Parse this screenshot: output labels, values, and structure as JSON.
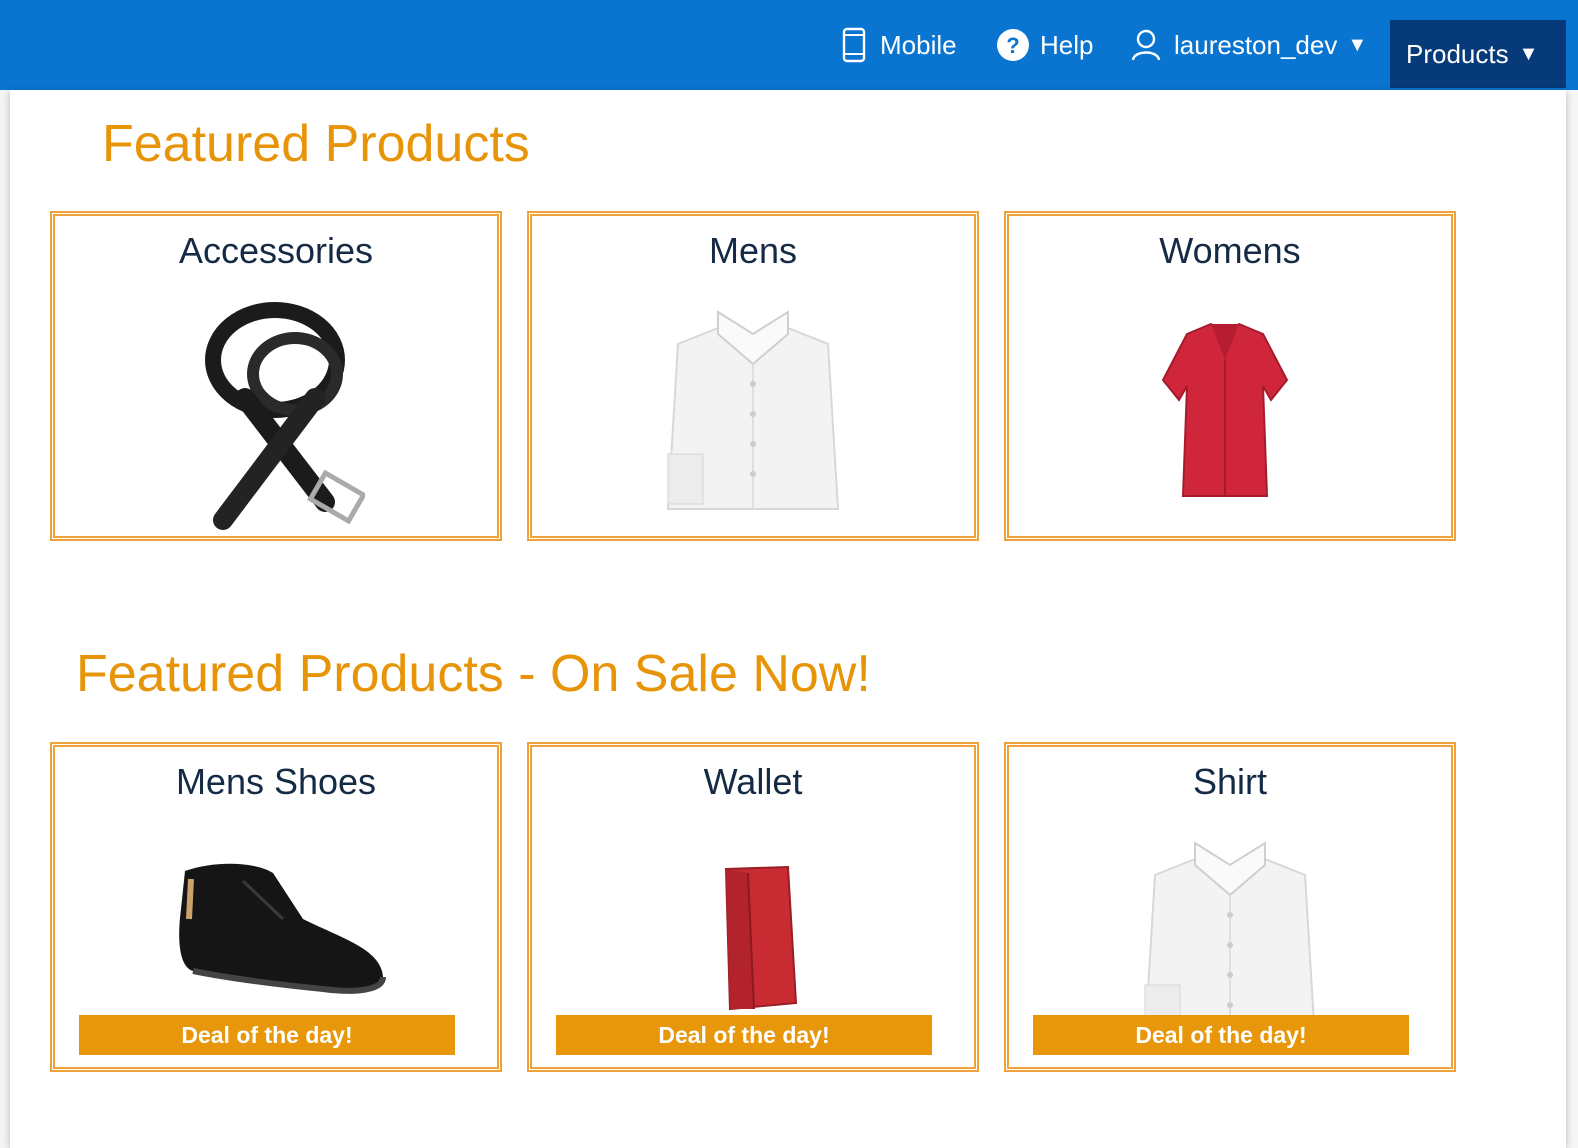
{
  "header": {
    "mobile_label": "Mobile",
    "help_label": "Help",
    "user_label": "laureston_dev",
    "products_label": "Products",
    "caret": "▼",
    "background_color": "#0a74d1",
    "active_color": "#073a78"
  },
  "featured": {
    "title": "Featured Products",
    "items": [
      {
        "label": "Accessories",
        "image": "belt-image"
      },
      {
        "label": "Mens",
        "image": "white-shirt-image"
      },
      {
        "label": "Womens",
        "image": "red-blouse-image"
      }
    ]
  },
  "sale": {
    "title": "Featured Products - On Sale Now!",
    "deal_label": "Deal of the day!",
    "items": [
      {
        "label": "Mens Shoes",
        "image": "shoe-image",
        "deal": "Deal of the day!"
      },
      {
        "label": "Wallet",
        "image": "wallet-image",
        "deal": "Deal of the day!"
      },
      {
        "label": "Shirt",
        "image": "white-shirt-image",
        "deal": "Deal of the day!"
      }
    ]
  },
  "colors": {
    "accent": "#e89408",
    "card_border": "#f0a23a",
    "title_text": "#152a44"
  }
}
